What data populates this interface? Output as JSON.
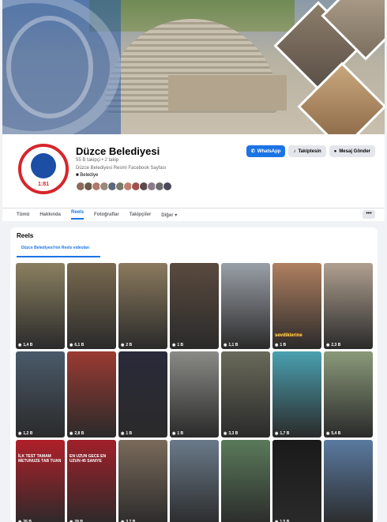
{
  "page": {
    "name": "Düzce Belediyesi",
    "stats": "55 B takipçi • 2 takip",
    "description": "Düzce Belediyesi Resmi Facebook Sayfası",
    "category": "Belediye",
    "logo_year": "1:81"
  },
  "buttons": {
    "whatsapp": "WhatsApp",
    "following": "Takiptesin",
    "message": "Mesaj Gönder",
    "more": "•••"
  },
  "tabs": [
    "Tümü",
    "Hakkında",
    "Reels",
    "Fotoğraflar",
    "Takipçiler",
    "Diğer ▾"
  ],
  "active_tab": "Reels",
  "reels": {
    "title": "Reels",
    "subtab": "Düzce Belediyesi'nin Reels videoları",
    "items": [
      {
        "views": "1,4 B",
        "color": "#8a8060"
      },
      {
        "views": "6,1 B",
        "color": "#7a6a50"
      },
      {
        "views": "2 B",
        "color": "#8b7a5e"
      },
      {
        "views": "1 B",
        "color": "#5a4a3e"
      },
      {
        "views": "1,1 B",
        "color": "#9aa0a8"
      },
      {
        "views": "1 B",
        "color": "#b08060",
        "caption2": "sevdiklerine"
      },
      {
        "views": "2,3 B",
        "color": "#b0a090"
      },
      {
        "views": "1,2 B",
        "color": "#4a5a6a"
      },
      {
        "views": "2,8 B",
        "color": "#9a3a32"
      },
      {
        "views": "1 B",
        "color": "#2a2a3a"
      },
      {
        "views": "1 B",
        "color": "#8a8a86"
      },
      {
        "views": "3,3 B",
        "color": "#6a6a5a"
      },
      {
        "views": "1,7 B",
        "color": "#4aa0b0"
      },
      {
        "views": "5,4 B",
        "color": "#8a9a7a"
      },
      {
        "views": "26 B",
        "color": "#b0202a",
        "caption": "İLK TEST TAMAM METUNUZE TAB TUAN"
      },
      {
        "views": "28 B",
        "color": "#a0202a",
        "caption": "EN UZUN GECE EN UZUN 45 SANIYE"
      },
      {
        "views": "3,7 B",
        "color": "#7a6a5a"
      },
      {
        "views": "",
        "color": "#6a7a8a"
      },
      {
        "views": "",
        "color": "#5a7a5a"
      },
      {
        "views": "1,5 B",
        "color": "#1a1a1a"
      },
      {
        "views": "",
        "color": "#5a7aa0"
      }
    ]
  }
}
